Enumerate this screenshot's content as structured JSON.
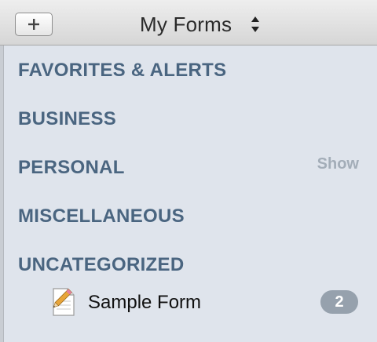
{
  "header": {
    "title": "My Forms",
    "add_icon": "plus-icon",
    "sort_icon": "up-down-arrows-icon"
  },
  "sections": [
    {
      "label": "FAVORITES & ALERTS"
    },
    {
      "label": "BUSINESS"
    },
    {
      "label": "PERSONAL",
      "action": "Show"
    },
    {
      "label": "MISCELLANEOUS"
    },
    {
      "label": "UNCATEGORIZED"
    }
  ],
  "forms": [
    {
      "label": "Sample Form",
      "count": "2",
      "icon": "form-document-pencil-icon"
    }
  ],
  "colors": {
    "section_text": "#4a6580",
    "sidebar_bg": "#dfe4ec",
    "badge_bg": "#96a1ad",
    "show_text": "#a3adb8"
  }
}
